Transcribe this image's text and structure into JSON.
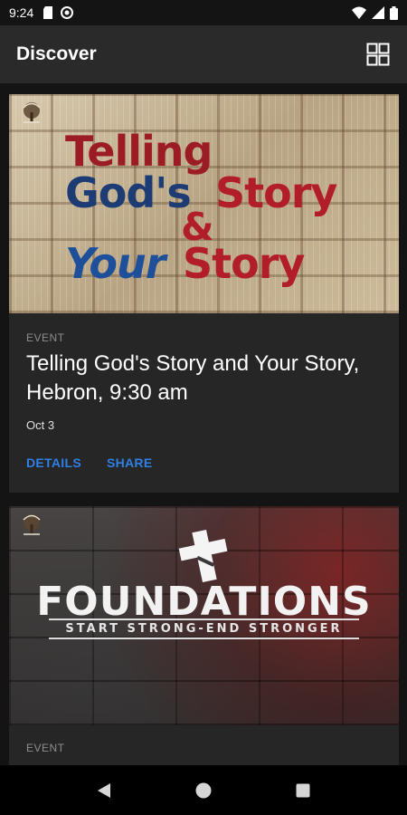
{
  "status_bar": {
    "time": "9:24"
  },
  "app_bar": {
    "title": "Discover",
    "layout_icon": "grid-view-icon"
  },
  "cards": [
    {
      "image_alt": "Telling God's Story & Your Story",
      "image_text": {
        "line1": "Telling",
        "line2a": "God's",
        "line2b": "Story",
        "line3": "&",
        "line4a": "Your",
        "line4b": "Story"
      },
      "kicker": "EVENT",
      "title": "Telling God's Story and Your Story, Hebron, 9:30 am",
      "date": "Oct 3",
      "actions": [
        "DETAILS",
        "SHARE"
      ]
    },
    {
      "image_alt": "Foundations - Start Strong - End Stronger",
      "image_text": {
        "headline": "FOUNDATIONS",
        "tagline": "START STRONG-END STRONGER"
      },
      "kicker": "EVENT"
    }
  ],
  "colors": {
    "accent": "#2f7fe4",
    "card_bg": "#262626",
    "app_bar_bg": "#2a2a2a"
  }
}
